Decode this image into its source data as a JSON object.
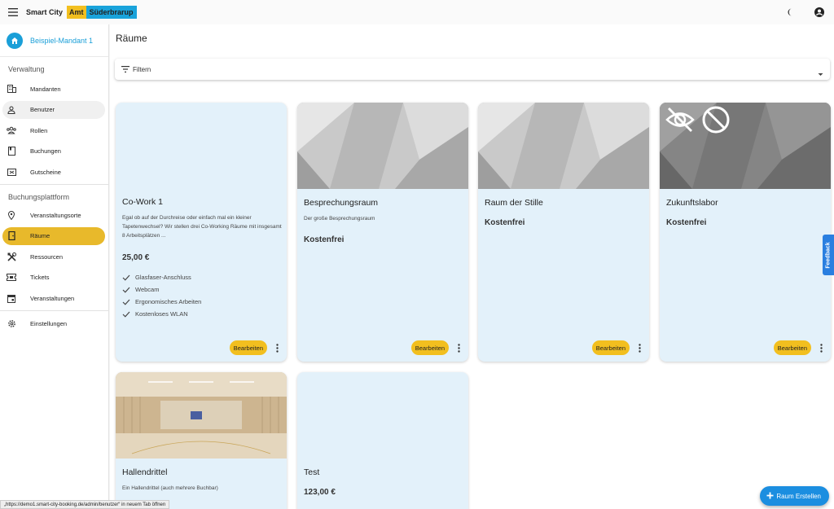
{
  "app": {
    "brand_name": "Smart City",
    "brand_tag": "Amt",
    "brand_place": "Süderbrarup"
  },
  "sidebar": {
    "tenant": "Beispiel-Mandant 1",
    "section_admin": "Verwaltung",
    "admin_items": [
      {
        "label": "Mandanten"
      },
      {
        "label": "Benutzer"
      },
      {
        "label": "Rollen"
      },
      {
        "label": "Buchungen"
      },
      {
        "label": "Gutscheine"
      }
    ],
    "section_platform": "Buchungsplattform",
    "platform_items": [
      {
        "label": "Veranstaltungsorte"
      },
      {
        "label": "Räume"
      },
      {
        "label": "Ressourcen"
      },
      {
        "label": "Tickets"
      },
      {
        "label": "Veranstaltungen"
      }
    ],
    "settings": "Einstellungen"
  },
  "main": {
    "title": "Räume",
    "filter_label": "Filtern",
    "edit_label": "Bearbeiten",
    "cards": [
      {
        "title": "Co-Work 1",
        "description": "Egal ob auf der Durchreise oder einfach mal ein kleiner Tapetenwechsel? Wir stellen drei Co-Working Räume mit insgesamt 8 Arbeitsplätzen ...",
        "price": "25,00 €",
        "features": [
          "Glasfaser-Anschluss",
          "Webcam",
          "Ergonomisches Arbeiten",
          "Kostenloses WLAN"
        ]
      },
      {
        "title": "Besprechungsraum",
        "description": "Der große Besprechungsraum",
        "price": "Kostenfrei"
      },
      {
        "title": "Raum der Stille",
        "price": "Kostenfrei"
      },
      {
        "title": "Zukunftslabor",
        "price": "Kostenfrei"
      },
      {
        "title": "Hallendrittel",
        "description": "Ein Hallendrittel (auch mehrere Buchbar)"
      },
      {
        "title": "Test",
        "price": "123,00 €"
      }
    ],
    "create_button": "Raum Erstellen"
  },
  "feedback_tab": "Feedback",
  "status_bar": "„https://demo1.smart-city-booking.de/admin/benutzer“ in neuem Tab öffnen",
  "colors": {
    "accent": "#1a9fd8",
    "active_nav": "#e8b92b",
    "edit_button": "#f2bf1f",
    "card_bg": "#e3f1fa",
    "fab": "#1b8ee0"
  }
}
